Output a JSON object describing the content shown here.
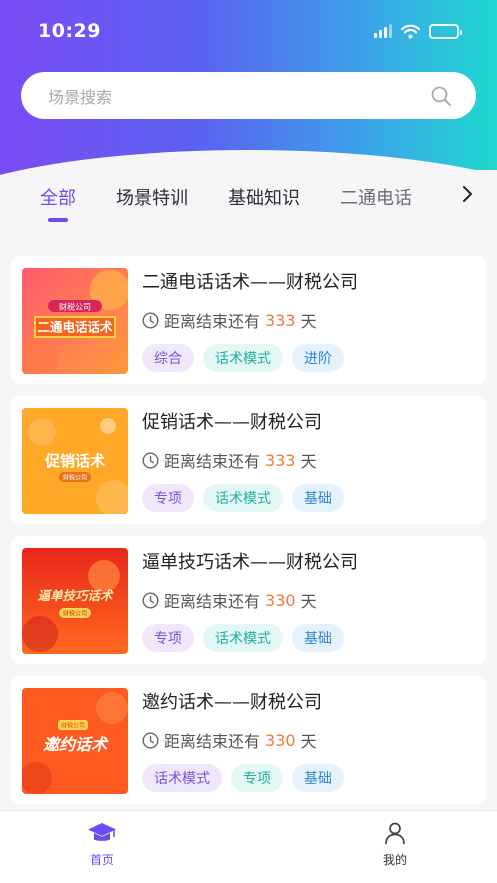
{
  "status_bar": {
    "time": "10:29"
  },
  "search": {
    "placeholder": "场景搜索"
  },
  "tabs": [
    {
      "label": "全部",
      "active": true
    },
    {
      "label": "场景特训",
      "active": false
    },
    {
      "label": "基础知识",
      "active": false
    },
    {
      "label": "二通电话",
      "active": false
    }
  ],
  "deadline_prefix": "距离结束还有",
  "deadline_unit": "天",
  "cards": [
    {
      "title": "二通电话话术——财税公司",
      "days": "333",
      "thumb_text": "二通电话话术",
      "thumb_badge": "财税公司",
      "tags": [
        {
          "label": "综合"
        },
        {
          "label": "话术模式"
        },
        {
          "label": "进阶"
        }
      ]
    },
    {
      "title": "促销话术——财税公司",
      "days": "333",
      "thumb_text": "促销话术",
      "thumb_badge": "财税公司",
      "tags": [
        {
          "label": "专项"
        },
        {
          "label": "话术模式"
        },
        {
          "label": "基础"
        }
      ]
    },
    {
      "title": "逼单技巧话术——财税公司",
      "days": "330",
      "thumb_text": "逼单技巧话术",
      "thumb_badge": "财税公司",
      "tags": [
        {
          "label": "专项"
        },
        {
          "label": "话术模式"
        },
        {
          "label": "基础"
        }
      ]
    },
    {
      "title": "邀约话术——财税公司",
      "days": "330",
      "thumb_text": "邀约话术",
      "thumb_badge": "财税公司",
      "tags": [
        {
          "label": "话术模式"
        },
        {
          "label": "专项"
        },
        {
          "label": "基础"
        }
      ]
    }
  ],
  "bottom_nav": [
    {
      "label": "首页",
      "icon": "graduation-cap-icon",
      "active": true
    },
    {
      "label": "我的",
      "icon": "person-icon",
      "active": false
    }
  ],
  "colors": {
    "accent": "#6b4cf2",
    "header_gradient": [
      "#7a4cf5",
      "#3aa6e8",
      "#1fd8cf"
    ],
    "deadline_days": "#f07a3a"
  }
}
